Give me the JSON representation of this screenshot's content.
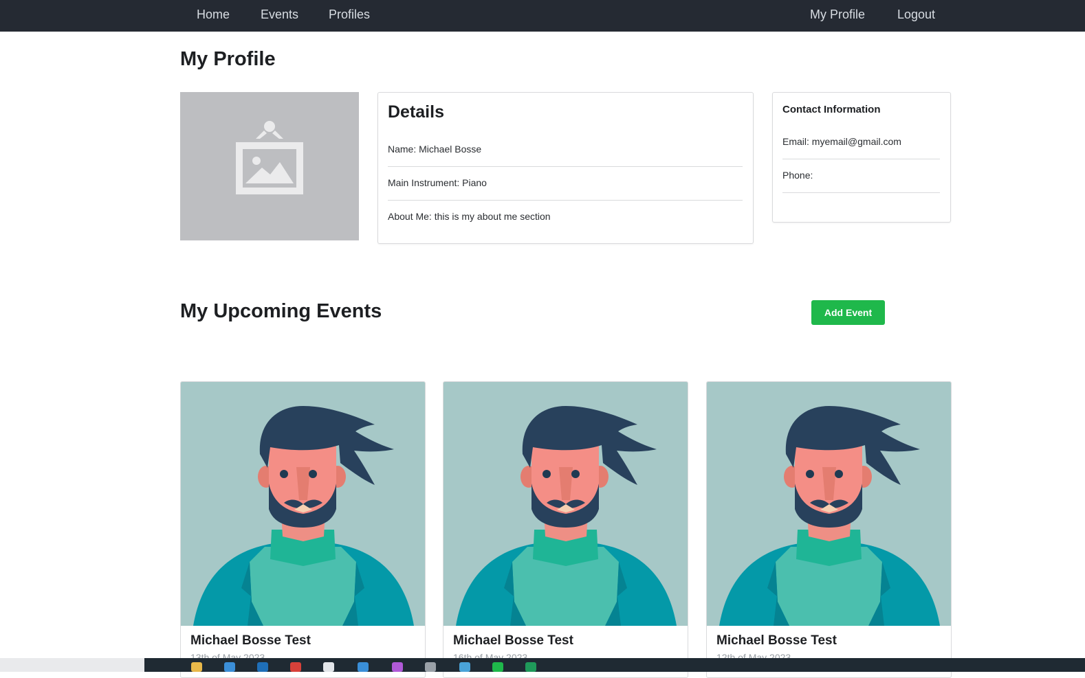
{
  "nav": {
    "home": "Home",
    "events": "Events",
    "profiles": "Profiles",
    "my_profile": "My Profile",
    "logout": "Logout"
  },
  "page": {
    "title": "My Profile"
  },
  "details": {
    "title": "Details",
    "name": "Name: Michael Bosse",
    "instrument": "Main Instrument: Piano",
    "about": "About Me: this is my about me section"
  },
  "contact": {
    "title": "Contact Information",
    "email": "Email: myemail@gmail.com",
    "phone": "Phone:"
  },
  "events_section": {
    "title": "My Upcoming Events",
    "add_button": "Add Event"
  },
  "events": [
    {
      "title": "Michael Bosse Test",
      "date": "13th of May 2023"
    },
    {
      "title": "Michael Bosse Test",
      "date": "16th of May 2023"
    },
    {
      "title": "Michael Bosse Test",
      "date": "12th of May 2023"
    }
  ],
  "colors": {
    "navbar": "#252a33",
    "add_button": "#1fb84b",
    "event_image_bg": "#a6c8c7"
  },
  "icons": {
    "profile_placeholder": "image-placeholder-icon",
    "event_image": "bearded-man-avatar"
  }
}
